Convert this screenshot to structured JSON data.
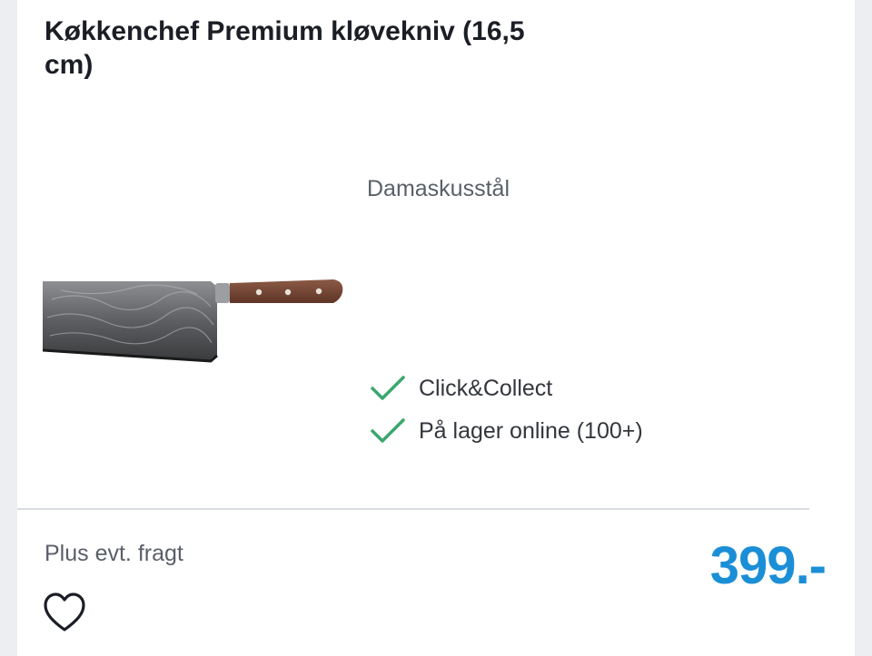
{
  "product": {
    "title": "Køkkenchef Premium kløvekniv (16,5 cm)",
    "material": "Damaskusstål",
    "image_icon": "cleaver-knife"
  },
  "availability": [
    {
      "label": "Click&Collect",
      "icon": "checkmark-icon",
      "color": "#3aa76d"
    },
    {
      "label": "På lager online (100+)",
      "icon": "checkmark-icon",
      "color": "#3aa76d"
    }
  ],
  "footer": {
    "shipping_note": "Plus evt. fragt",
    "price": "399.-",
    "price_color": "#1b8fd6",
    "favorite_icon": "heart-outline-icon"
  }
}
